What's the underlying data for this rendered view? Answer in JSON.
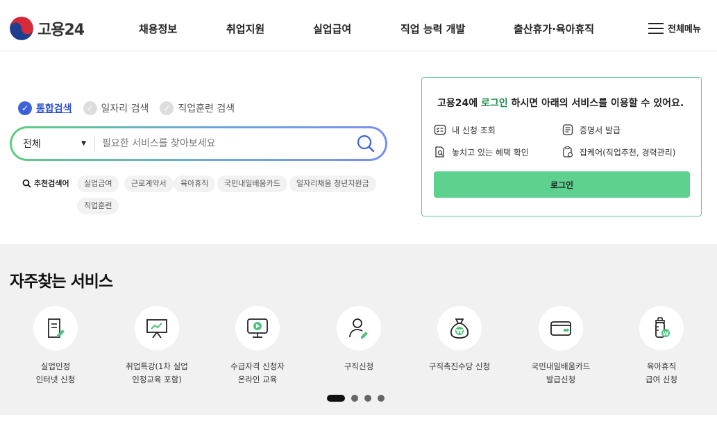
{
  "header": {
    "logo_text": "고용24",
    "nav": [
      "채용정보",
      "취업지원",
      "실업급여",
      "직업 능력 개발",
      "출산휴가·육아휴직"
    ],
    "all_menu": "전체메뉴"
  },
  "search": {
    "tabs": [
      {
        "label": "통합검색",
        "active": true
      },
      {
        "label": "일자리 검색",
        "active": false
      },
      {
        "label": "직업훈련 검색",
        "active": false
      }
    ],
    "category": "전체",
    "placeholder": "필요한 서비스를 찾아보세요",
    "recommend_label": "추천검색어",
    "keywords": [
      "실업급여",
      "근로계약서",
      "육아휴직",
      "국민내일배움카드",
      "일자리채움 청년지원금",
      "직업훈련"
    ]
  },
  "login": {
    "msg_pre": "고용24에 ",
    "msg_highlight": "로그인",
    "msg_post": " 하시면 아래의 서비스를 이용할 수 있어요.",
    "services": [
      "내 신청 조회",
      "증명서 발급",
      "놓치고 있는 혜택 확인",
      "잡케어(직업추천, 경력관리)"
    ],
    "button": "로그인",
    "accent": "#5dd18d"
  },
  "frequent": {
    "title": "자주찾는 서비스",
    "items": [
      {
        "line1": "실업인정",
        "line2": "인터넷 신청",
        "icon": "document-pen-icon"
      },
      {
        "line1": "취업특강(1차 실업",
        "line2": "인정교육 포함)",
        "icon": "lecture-board-icon"
      },
      {
        "line1": "수급자격 신청자",
        "line2": "온라인 교육",
        "icon": "monitor-play-icon"
      },
      {
        "line1": "구직신청",
        "line2": "",
        "icon": "person-pen-icon"
      },
      {
        "line1": "구직촉진수당 신청",
        "line2": "",
        "icon": "money-bag-icon"
      },
      {
        "line1": "국민내일배움카드",
        "line2": "발급신청",
        "icon": "card-icon"
      },
      {
        "line1": "육아휴직",
        "line2": "급여 신청",
        "icon": "baby-bottle-icon"
      }
    ],
    "pagination_current": 1,
    "pagination_total": 4
  }
}
